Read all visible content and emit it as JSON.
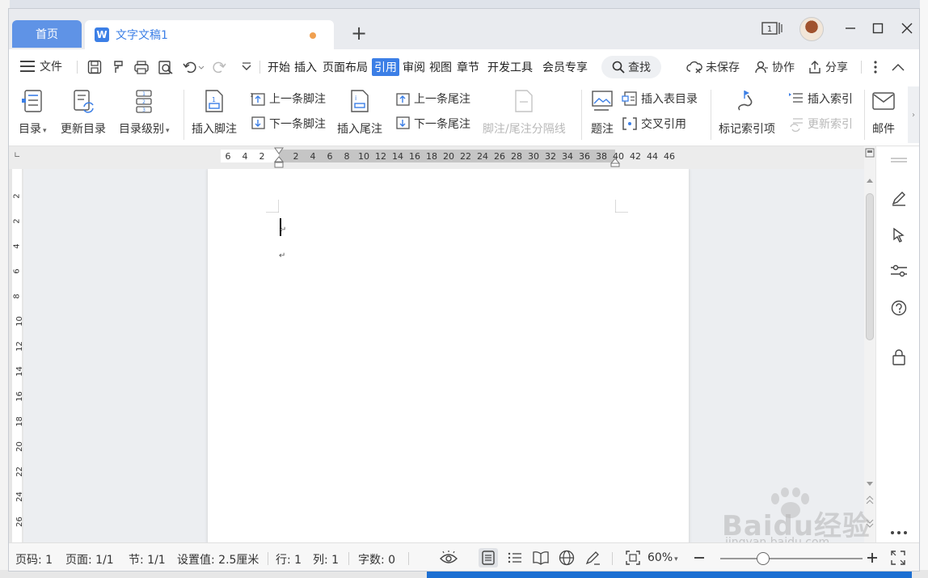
{
  "tabs": {
    "home": "首页",
    "document": "文字文稿1",
    "add": "+"
  },
  "window": {
    "page_count_indicator": "1"
  },
  "menu": {
    "file": "文件",
    "tabs": [
      "开始",
      "插入",
      "页面布局",
      "引用",
      "审阅",
      "视图",
      "章节",
      "开发工具",
      "会员专享"
    ],
    "active_tab": "引用",
    "search": "查找",
    "unsaved": "未保存",
    "collaborate": "协作",
    "share": "分享"
  },
  "ribbon": {
    "toc": "目录",
    "update_toc": "更新目录",
    "toc_level": "目录级别",
    "insert_footnote": "插入脚注",
    "prev_footnote": "上一条脚注",
    "next_footnote": "下一条脚注",
    "insert_endnote": "插入尾注",
    "prev_endnote": "上一条尾注",
    "next_endnote": "下一条尾注",
    "note_separator": "脚注/尾注分隔线",
    "caption": "题注",
    "insert_table_of_figures": "插入表目录",
    "cross_reference": "交叉引用",
    "mark_index_entry": "标记索引项",
    "insert_index": "插入索引",
    "update_index": "更新索引",
    "mail": "邮件"
  },
  "ruler": {
    "left_numbers": [
      "6",
      "4",
      "2"
    ],
    "right_numbers": [
      "2",
      "4",
      "6",
      "8",
      "10",
      "12",
      "14",
      "16",
      "18",
      "20",
      "22",
      "24",
      "26",
      "28",
      "30",
      "32",
      "34",
      "36",
      "38",
      "40",
      "42",
      "44",
      "46"
    ],
    "vertical_numbers": [
      "2",
      "2",
      "4",
      "6",
      "8",
      "10",
      "12",
      "14",
      "16",
      "18",
      "20",
      "22",
      "24",
      "26"
    ]
  },
  "status": {
    "page_num": "页码: 1",
    "pages": "页面: 1/1",
    "section": "节: 1/1",
    "setting": "设置值: 2.5厘米",
    "line": "行: 1",
    "column": "列: 1",
    "word_count": "字数: 0",
    "zoom": "60%",
    "zoom_level": 0.3
  },
  "watermark": {
    "brand": "Baidu经验",
    "url": "jingyan.baidu.com"
  },
  "colors": {
    "accent": "#3c7fe6",
    "home_tab": "#5f93e6",
    "unsaved_dot": "#f0a050"
  }
}
